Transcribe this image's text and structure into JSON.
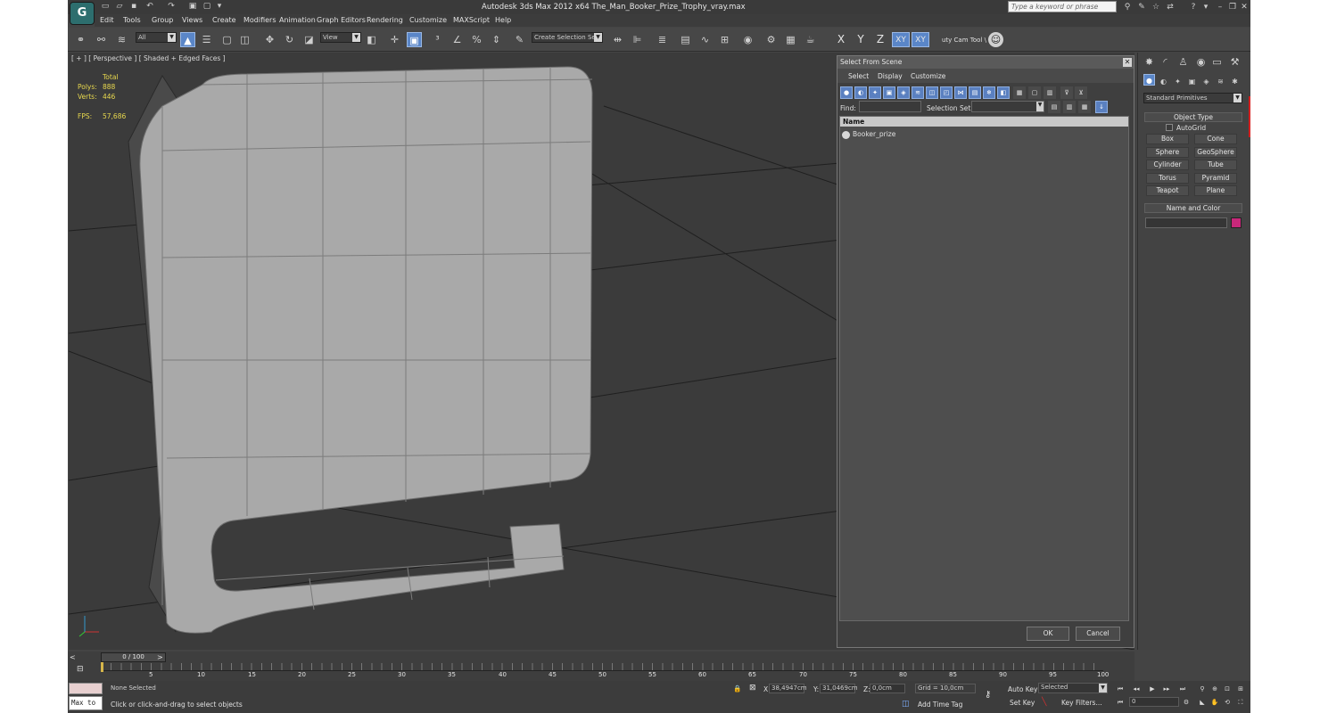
{
  "window": {
    "title": "Autodesk 3ds Max  2012 x64      The_Man_Booker_Prize_Trophy_vray.max",
    "search_placeholder": "Type a keyword or phrase",
    "logo_letter": "G"
  },
  "menu": [
    "Edit",
    "Tools",
    "Group",
    "Views",
    "Create",
    "Modifiers",
    "Animation",
    "Graph Editors",
    "Rendering",
    "Customize",
    "MAXScript",
    "Help"
  ],
  "toolbar": {
    "filter_combo": "All",
    "view_combo": "View",
    "selection_set_combo": "Create Selection Se",
    "axis_x": "X",
    "axis_y": "Y",
    "axis_z": "Z",
    "axis_xy": "XY",
    "axis_xy2": "XY",
    "cam_tool": "uty Cam Tool \\"
  },
  "viewport": {
    "label": "[ + ] [ Perspective ] [ Shaded + Edged Faces ]",
    "stats_header": "Total",
    "polys_label": "Polys:",
    "polys_value": "888",
    "verts_label": "Verts:",
    "verts_value": "446",
    "fps_label": "FPS:",
    "fps_value": "57,686"
  },
  "dialog": {
    "title": "Select From Scene",
    "menu": [
      "Select",
      "Display",
      "Customize"
    ],
    "find_label": "Find:",
    "selection_set_label": "Selection Set:",
    "column_name": "Name",
    "items": [
      "Booker_prize"
    ],
    "ok": "OK",
    "cancel": "Cancel"
  },
  "command_panel": {
    "dropdown": "Standard Primitives",
    "object_type_title": "Object Type",
    "autogrid": "AutoGrid",
    "primitives": [
      "Box",
      "Cone",
      "Sphere",
      "GeoSphere",
      "Cylinder",
      "Tube",
      "Torus",
      "Pyramid",
      "Teapot",
      "Plane"
    ],
    "name_color_title": "Name and Color",
    "swatch_color": "#c8287a"
  },
  "timeline": {
    "slider_label": "0 / 100",
    "ticks": [
      "5",
      "10",
      "15",
      "20",
      "25",
      "30",
      "35",
      "40",
      "45",
      "50",
      "55",
      "60",
      "65",
      "70",
      "75",
      "80",
      "85",
      "90",
      "95",
      "100"
    ]
  },
  "status": {
    "selection": "None Selected",
    "prompt": "Click or click-and-drag to select objects",
    "maxscript": "Max to",
    "x_label": "X:",
    "x_value": "38,4947cm",
    "y_label": "Y:",
    "y_value": "31,0469cm",
    "z_label": "Z:",
    "z_value": "0,0cm",
    "grid": "Grid = 10,0cm",
    "add_time_tag": "Add Time Tag",
    "auto_key": "Auto Key",
    "selected": "Selected",
    "set_key": "Set Key",
    "key_filters": "Key Filters...",
    "frame": "0"
  }
}
